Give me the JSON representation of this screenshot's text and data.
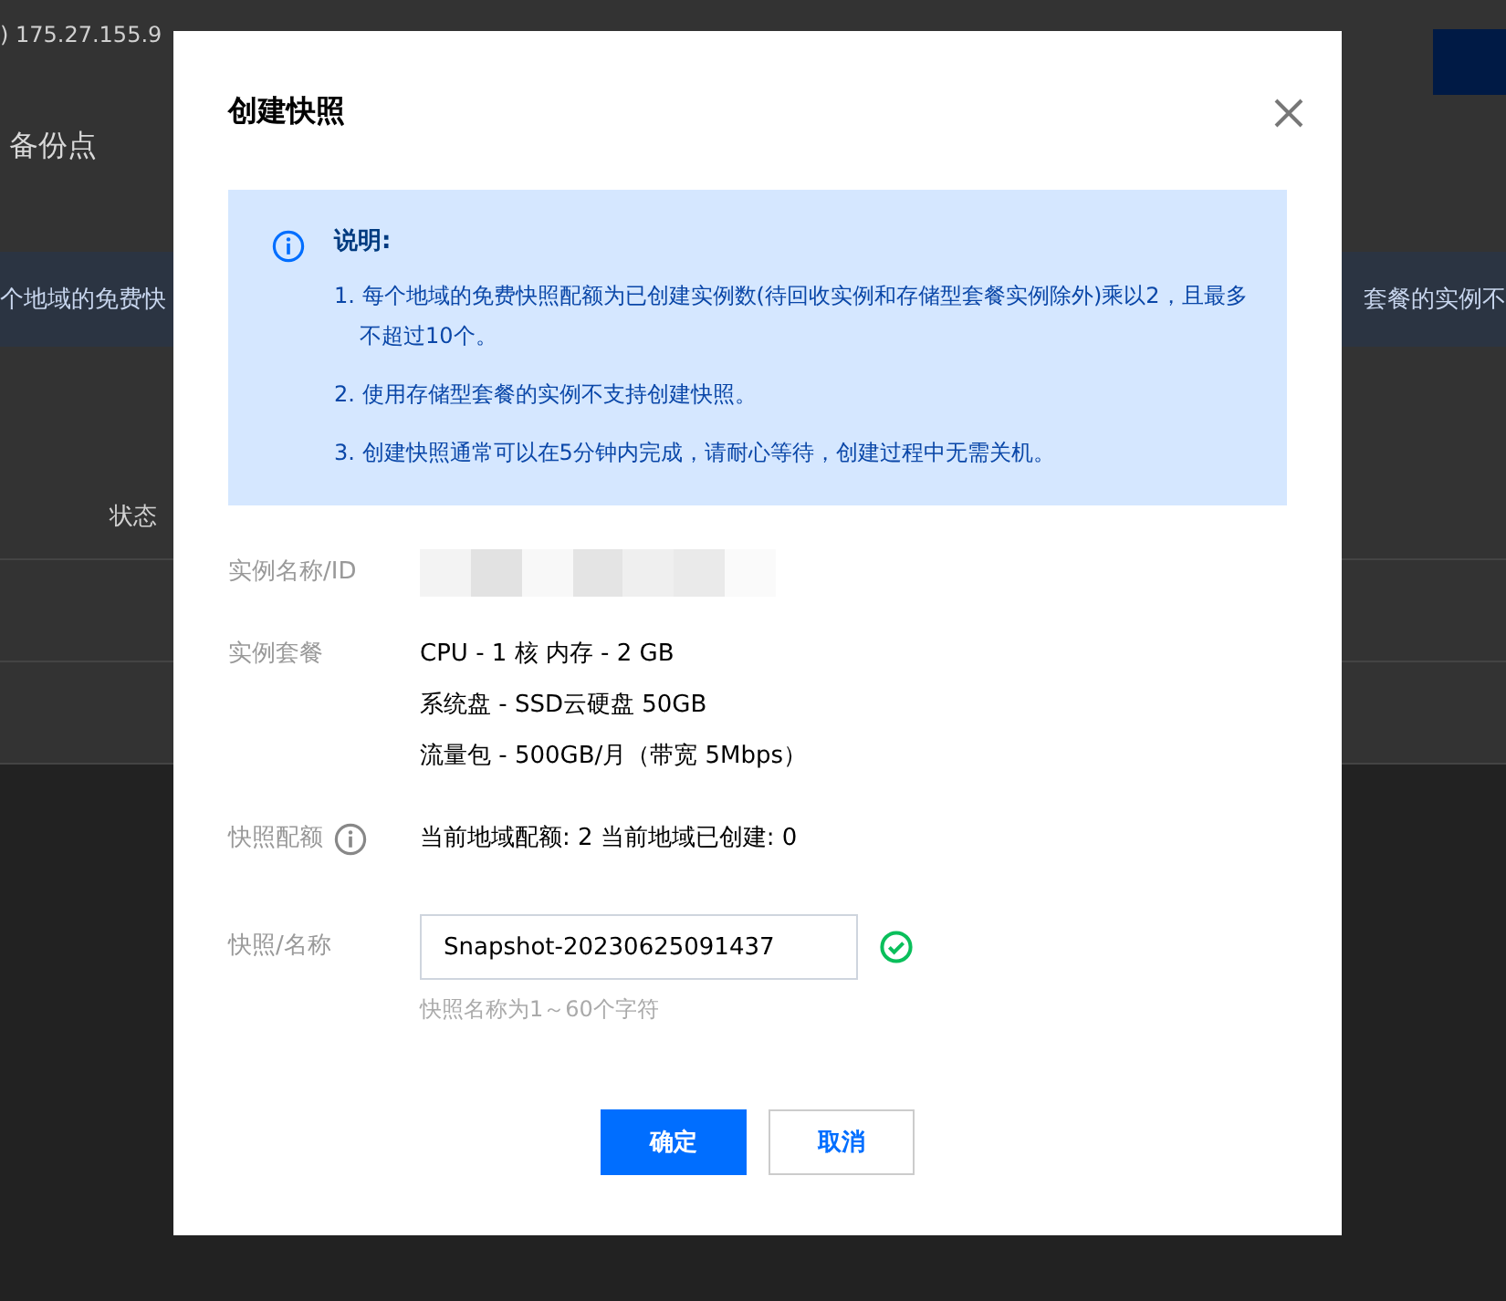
{
  "background": {
    "ip_text": ") 175.27.155.9",
    "section_title": "备份点",
    "notice_left": "个地域的免费快",
    "notice_right": "套餐的实例不",
    "table_header": "状态"
  },
  "dialog": {
    "title": "创建快照",
    "notice": {
      "heading": "说明:",
      "items": [
        "1. 每个地域的免费快照配额为已创建实例数(待回收实例和存储型套餐实例除外)乘以2，且最多不超过10个。",
        "2. 使用存储型套餐的实例不支持创建快照。",
        "3. 创建快照通常可以在5分钟内完成，请耐心等待，创建过程中无需关机。"
      ]
    },
    "fields": [
      {
        "kind": "redacted",
        "label": "实例名称/ID"
      },
      {
        "kind": "lines",
        "label": "实例套餐",
        "lines": [
          "CPU - 1 核 内存 - 2 GB",
          "系统盘 - SSD云硬盘 50GB",
          "流量包 - 500GB/月（带宽 5Mbps）"
        ]
      },
      {
        "kind": "info",
        "label": "快照配额",
        "value": "当前地域配额: 2 当前地域已创建: 0"
      },
      {
        "kind": "input",
        "label": "快照/名称",
        "value": "Snapshot-20230625091437",
        "valid": true,
        "hint": "快照名称为1～60个字符"
      }
    ],
    "buttons": [
      {
        "label": "确定",
        "primary": true
      },
      {
        "label": "取消",
        "primary": false
      }
    ]
  }
}
